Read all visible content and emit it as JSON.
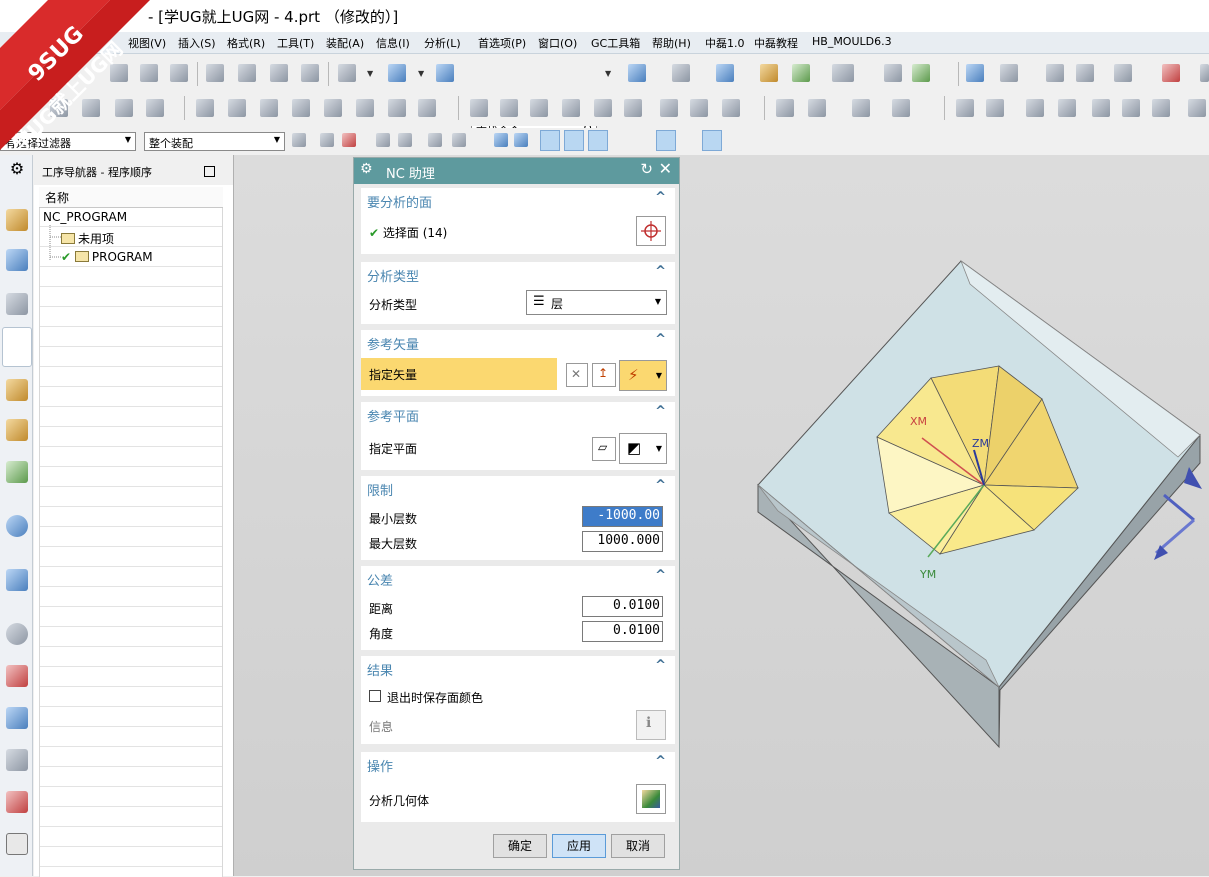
{
  "window": {
    "title": "- [学UG就上UG网 - 4.prt （修改的）]"
  },
  "watermark": {
    "line1": "9SUG",
    "line2": "学UG就上UG网"
  },
  "menu": [
    "视图(V)",
    "插入(S)",
    "格式(R)",
    "工具(T)",
    "装配(A)",
    "信息(I)",
    "分析(L)",
    "首选项(P)",
    "窗口(O)",
    "GC工具箱",
    "帮助(H)",
    "中磊1.0",
    "中磊教程",
    "HB_MOULD6.3"
  ],
  "toolbar": {
    "search_placeholder": "查找命令",
    "filter_value": "有选择过滤器",
    "assembly_value": "整个装配"
  },
  "navigator": {
    "title": "工序导航器 - 程序顺序",
    "column_name": "名称",
    "rows": [
      "NC_PROGRAM",
      "未用项",
      "PROGRAM"
    ]
  },
  "dialog": {
    "title": "NC 助理",
    "sec_faces": "要分析的面",
    "faces_selected": "选择面 (14)",
    "sec_type": "分析类型",
    "type_label": "分析类型",
    "type_value": "层",
    "sec_vector": "参考矢量",
    "vector_label": "指定矢量",
    "sec_plane": "参考平面",
    "plane_label": "指定平面",
    "sec_limits": "限制",
    "min_label": "最小层数",
    "min_value": "-1000.00",
    "max_label": "最大层数",
    "max_value": "1000.000",
    "sec_tol": "公差",
    "dist_label": "距离",
    "dist_value": "0.0100",
    "angle_label": "角度",
    "angle_value": "0.0100",
    "sec_results": "结果",
    "save_color_label": "退出时保存面颜色",
    "info_label": "信息",
    "sec_ops": "操作",
    "analyze_label": "分析几何体",
    "ok": "确定",
    "apply": "应用",
    "cancel": "取消"
  },
  "axes": {
    "xm": "XM",
    "ym": "YM",
    "zm": "ZM"
  },
  "colors": {
    "dialog_header": "#5e9a9e",
    "section_header": "#4a86b0",
    "vector_highlight": "#fbd870",
    "face_yellow": "#f6e27a",
    "plate": "#c9dde3"
  }
}
